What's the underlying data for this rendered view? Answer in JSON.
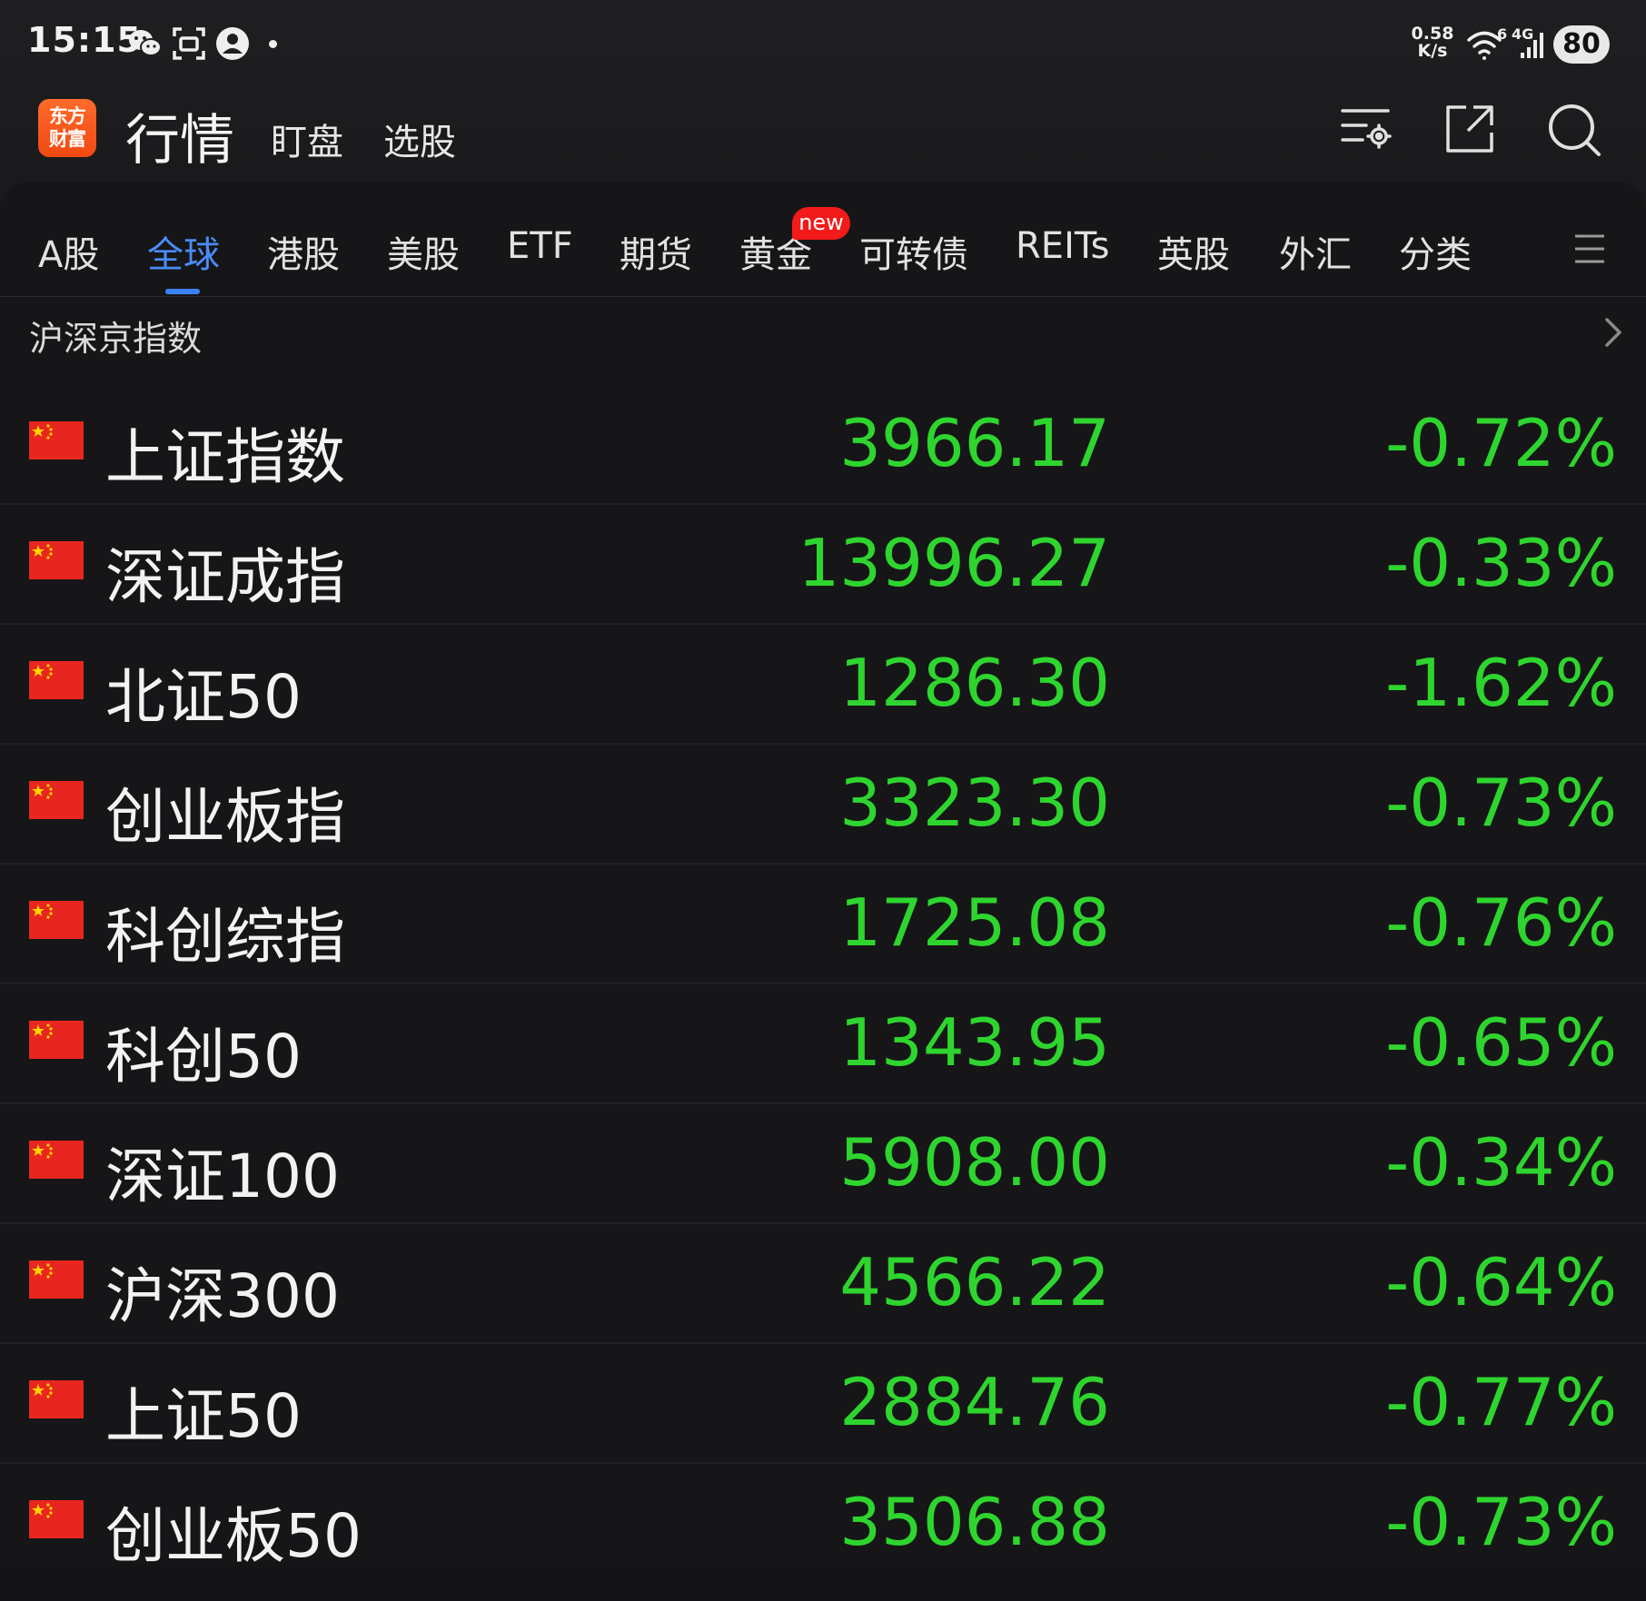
{
  "status_bar": {
    "time": "15:15",
    "icons": [
      "wechat-icon",
      "scan-icon",
      "account-icon"
    ],
    "net_speed_value": "0.58",
    "net_speed_unit": "K/s",
    "wifi_label": "6",
    "cell_label": "4G",
    "battery": "80"
  },
  "app_header": {
    "logo_line1": "东方",
    "logo_line2": "财富",
    "title": "行情",
    "tab1": "盯盘",
    "tab2": "选股",
    "icons": [
      "list-settings-icon",
      "share-icon",
      "search-icon"
    ]
  },
  "tabs": [
    {
      "label": "A股",
      "active": false
    },
    {
      "label": "全球",
      "active": true
    },
    {
      "label": "港股",
      "active": false
    },
    {
      "label": "美股",
      "active": false
    },
    {
      "label": "ETF",
      "active": false
    },
    {
      "label": "期货",
      "active": false
    },
    {
      "label": "黄金",
      "active": false
    },
    {
      "label": "可转债",
      "active": false
    },
    {
      "label": "REITs",
      "active": false
    },
    {
      "label": "英股",
      "active": false
    },
    {
      "label": "外汇",
      "active": false
    },
    {
      "label": "分类",
      "active": false
    }
  ],
  "new_badge": "new",
  "section": {
    "title": "沪深京指数"
  },
  "indices": [
    {
      "name": "上证指数",
      "price": "3966.17",
      "change": "-0.72%"
    },
    {
      "name": "深证成指",
      "price": "13996.27",
      "change": "-0.33%"
    },
    {
      "name": "北证50",
      "price": "1286.30",
      "change": "-1.62%"
    },
    {
      "name": "创业板指",
      "price": "3323.30",
      "change": "-0.73%"
    },
    {
      "name": "科创综指",
      "price": "1725.08",
      "change": "-0.76%"
    },
    {
      "name": "科创50",
      "price": "1343.95",
      "change": "-0.65%"
    },
    {
      "name": "深证100",
      "price": "5908.00",
      "change": "-0.34%"
    },
    {
      "name": "沪深300",
      "price": "4566.22",
      "change": "-0.64%"
    },
    {
      "name": "上证50",
      "price": "2884.76",
      "change": "-0.77%"
    },
    {
      "name": "创业板50",
      "price": "3506.88",
      "change": "-0.73%"
    }
  ],
  "colors": {
    "down": "#2ed52e",
    "accent": "#3b82f6",
    "badge": "#f21a1a",
    "brand": "#f05a1a"
  }
}
